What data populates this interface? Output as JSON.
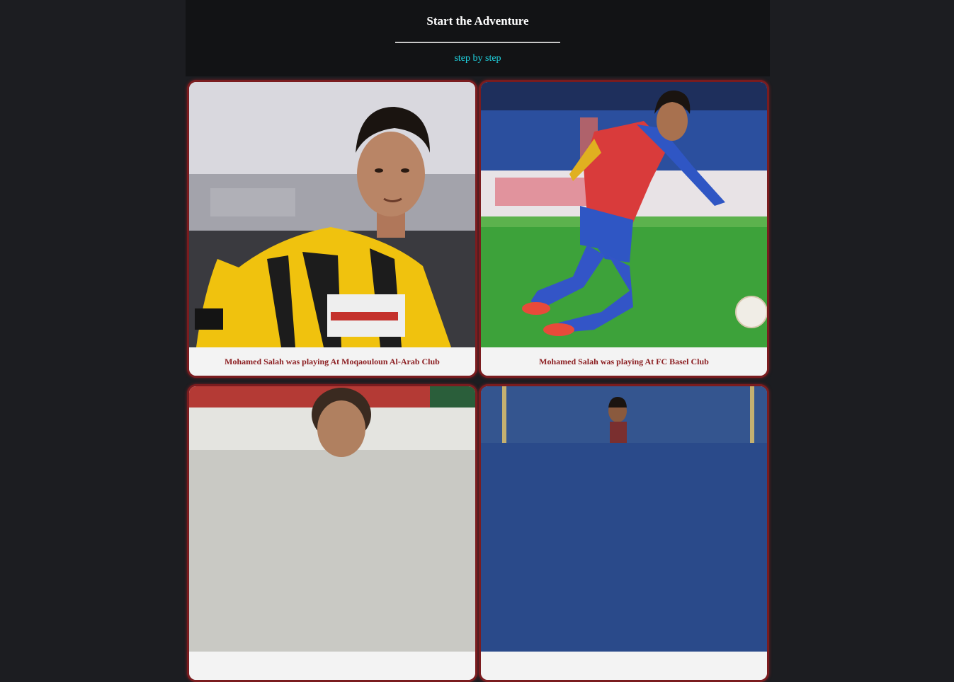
{
  "header": {
    "title": "Start the Adventure",
    "subtitle": "step by step"
  },
  "cards": [
    {
      "caption": "Mohamed Salah was playing At Moqaouloun Al-Arab Club",
      "photo": "player-yellow-black-kit"
    },
    {
      "caption": "Mohamed Salah was playing At FC Basel Club",
      "photo": "player-red-blue-kit"
    },
    {
      "caption": "",
      "photo": "player-curly-hair"
    },
    {
      "caption": "",
      "photo": "player-stadium"
    }
  ],
  "colors": {
    "page_background": "#1c1d21",
    "header_background": "#121315",
    "subtitle": "#1fd3e0",
    "card_border": "#7a1c1f",
    "caption_text": "#8c1f22"
  }
}
